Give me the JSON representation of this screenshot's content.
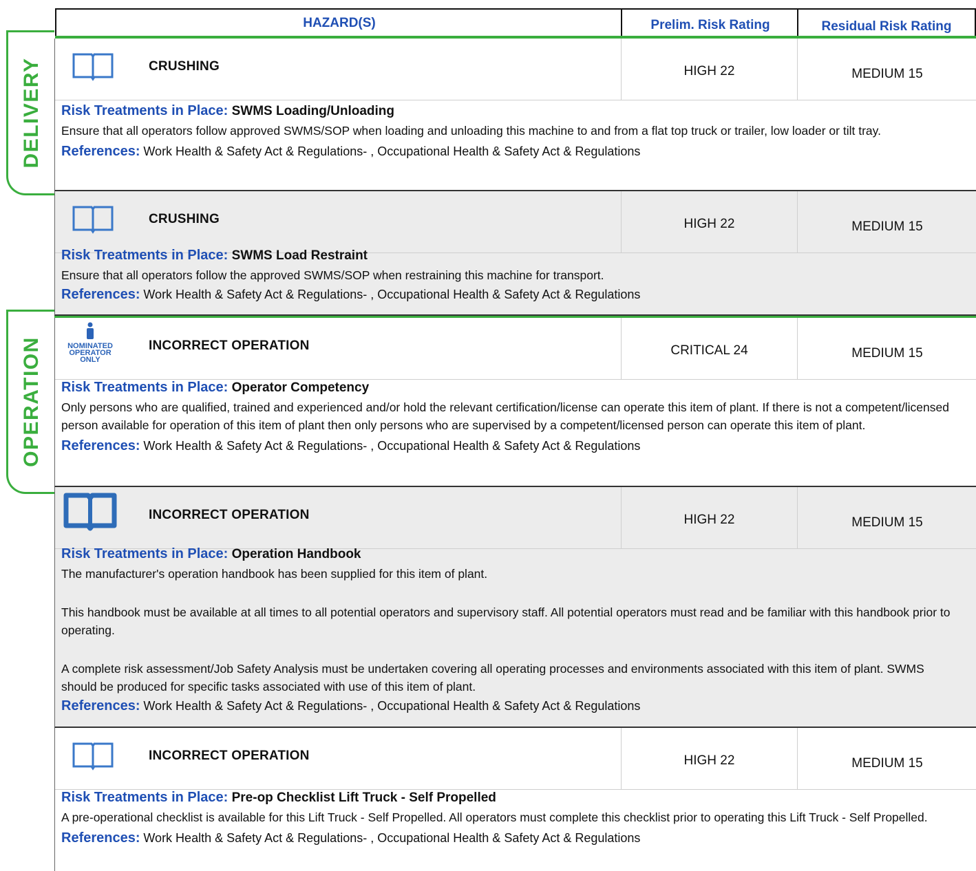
{
  "header": {
    "hazards": "HAZARD(S)",
    "prelim": "Prelim. Risk Rating",
    "residual": "Residual Risk Rating"
  },
  "sections": [
    {
      "label": "DELIVERY"
    },
    {
      "label": "OPERATION"
    }
  ],
  "colors": {
    "accent_green": "#3aae3e",
    "label_blue": "#1f4fb4"
  },
  "rows": [
    {
      "icon": "book-icon",
      "hazard": "CRUSHING",
      "prelim": "HIGH 22",
      "residual": "MEDIUM 15",
      "rt_label": "Risk Treatments in Place:",
      "rt_title": "SWMS Loading/Unloading",
      "text": [
        "Ensure that all operators follow approved SWMS/SOP when loading and unloading this machine to and from a flat top truck or trailer, low loader or tilt tray."
      ],
      "ref_label": "References:",
      "ref_value": "Work Health & Safety Act & Regulations- , Occupational Health & Safety Act & Regulations"
    },
    {
      "icon": "book-icon",
      "hazard": "CRUSHING",
      "prelim": "HIGH 22",
      "residual": "MEDIUM 15",
      "rt_label": "Risk Treatments in Place:",
      "rt_title": "SWMS Load Restraint",
      "text": [
        "Ensure that all operators follow the approved SWMS/SOP when restraining this machine for transport."
      ],
      "ref_label": "References:",
      "ref_value": "Work Health & Safety Act & Regulations- , Occupational Health & Safety Act & Regulations"
    },
    {
      "icon": "nominated-operator-icon",
      "icon_text": [
        "NOMINATED",
        "OPERATOR",
        "ONLY"
      ],
      "hazard": "INCORRECT OPERATION",
      "prelim": "CRITICAL 24",
      "residual": "MEDIUM 15",
      "rt_label": "Risk Treatments in Place:",
      "rt_title": "Operator Competency",
      "text": [
        "Only persons who are qualified, trained and experienced and/or hold the relevant certification/license can operate this item of plant. If there is not a competent/licensed person available for operation of this item of plant then only persons who are supervised by a competent/licensed person can operate this item of plant."
      ],
      "ref_label": "References:",
      "ref_value": "Work Health & Safety Act & Regulations- , Occupational Health & Safety Act & Regulations"
    },
    {
      "icon": "handbook-icon",
      "hazard": "INCORRECT OPERATION",
      "prelim": "HIGH 22",
      "residual": "MEDIUM 15",
      "rt_label": "Risk Treatments in Place:",
      "rt_title": "Operation Handbook",
      "text": [
        "The manufacturer's operation handbook has been supplied for this item of plant.",
        "This handbook must be available at all times to all potential operators and supervisory staff. All potential operators must read and be familiar with this handbook prior to operating.",
        "A complete risk assessment/Job Safety Analysis must be undertaken covering all operating processes and environments associated with this item of plant. SWMS should be produced for specific tasks associated with use of this item of plant."
      ],
      "ref_label": "References:",
      "ref_value": "Work Health & Safety Act & Regulations- , Occupational Health & Safety Act & Regulations"
    },
    {
      "icon": "book-icon",
      "hazard": "INCORRECT OPERATION",
      "prelim": "HIGH 22",
      "residual": "MEDIUM 15",
      "rt_label": "Risk Treatments in Place:",
      "rt_title": "Pre-op Checklist Lift Truck - Self Propelled",
      "text": [
        "A pre-operational checklist is available for this Lift Truck - Self Propelled. All operators must complete this checklist prior to operating this Lift Truck - Self Propelled."
      ],
      "ref_label": "References:",
      "ref_value": "Work Health & Safety Act & Regulations- , Occupational Health & Safety Act & Regulations"
    }
  ]
}
